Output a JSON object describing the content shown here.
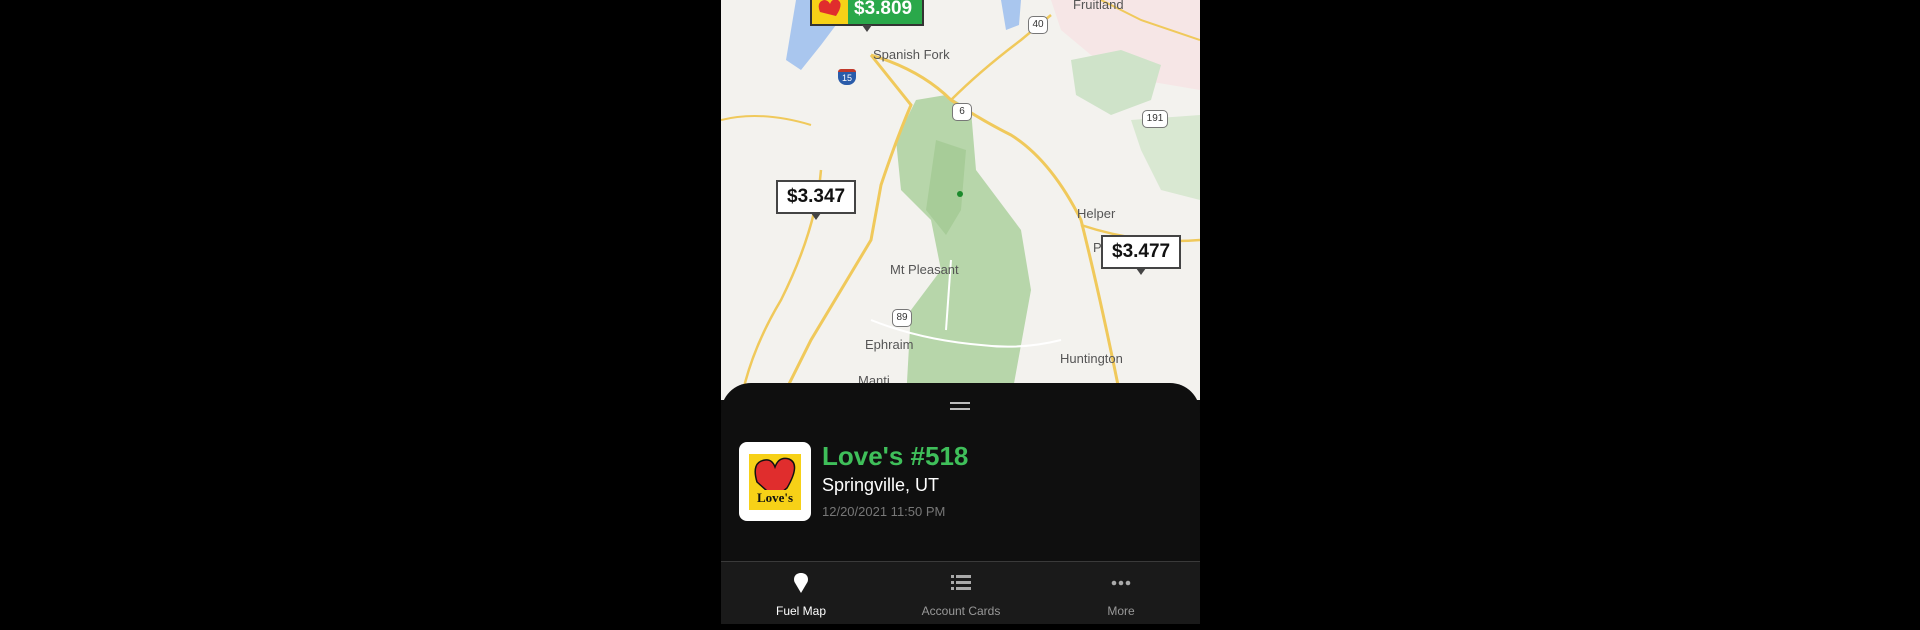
{
  "map": {
    "towns": {
      "spanish_fork": "Spanish Fork",
      "mt_pleasant": "Mt Pleasant",
      "ephraim": "Ephraim",
      "manti": "Manti",
      "helper": "Helper",
      "huntington": "Huntington",
      "fruitland": "Fruitland",
      "price_town": "P"
    },
    "routes": {
      "i15": "15",
      "us40": "40",
      "us6": "6",
      "us191": "191",
      "us89": "89"
    },
    "price_markers": {
      "featured": "$3.809",
      "west": "$3.347",
      "east": "$3.477"
    }
  },
  "station": {
    "name": "Love's #518",
    "location": "Springville, UT",
    "timestamp": "12/20/2021 11:50 PM",
    "logo_text": "Love's"
  },
  "nav": {
    "items": [
      {
        "label": "Fuel Map",
        "icon": "map-pin-icon",
        "active": true
      },
      {
        "label": "Account Cards",
        "icon": "list-icon",
        "active": false
      },
      {
        "label": "More",
        "icon": "more-dots-icon",
        "active": false
      }
    ]
  },
  "colors": {
    "accent_green": "#3fbf5a",
    "featured_marker": "#2aa84a",
    "sheet_bg": "#0f0f0f",
    "navbar_bg": "#1a1a1a"
  }
}
